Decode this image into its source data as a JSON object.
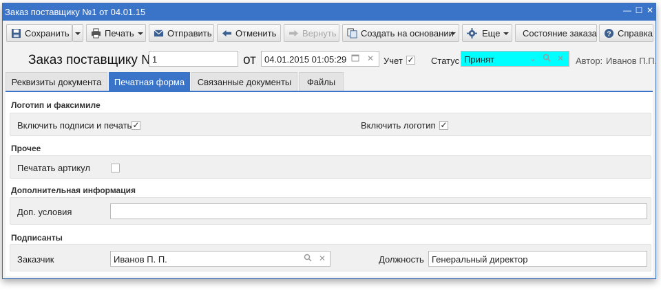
{
  "window": {
    "title": "Заказ поставщику №1 от 04.01.15",
    "controls": {
      "minimize": "—",
      "maximize": "☐",
      "close": "✕"
    }
  },
  "toolbar": {
    "save": "Сохранить",
    "print": "Печать",
    "send": "Отправить",
    "cancel": "Отменить",
    "return": "Вернуть",
    "create_basis": "Создать на основании",
    "more": "Еще",
    "order_status": "Состояние заказа",
    "help": "Справка"
  },
  "doc": {
    "title": "Заказ поставщику №",
    "number": "1",
    "from_label": "от",
    "date": "04.01.2015 01:05:29",
    "accounting_label": "Учет",
    "accounting_checked": true,
    "status_label": "Статус",
    "status_value": "Принят",
    "status_color": "#00ffff",
    "author_label": "Автор:",
    "author_value": "Иванов П.П."
  },
  "tabs": [
    {
      "label": "Реквизиты документа",
      "active": false
    },
    {
      "label": "Печатная форма",
      "active": true
    },
    {
      "label": "Связанные документы",
      "active": false
    },
    {
      "label": "Файлы",
      "active": false
    }
  ],
  "sections": {
    "logo": {
      "title": "Логотип и факсимиле",
      "include_signatures_label": "Включить подписи и печать",
      "include_signatures_checked": true,
      "include_logo_label": "Включить логотип",
      "include_logo_checked": true
    },
    "other": {
      "title": "Прочее",
      "print_article_label": "Печатать артикул",
      "print_article_checked": false
    },
    "additional": {
      "title": "Дополнительная информация",
      "conditions_label": "Доп. условия",
      "conditions_value": ""
    },
    "signers": {
      "title": "Подписанты",
      "customer_label": "Заказчик",
      "customer_value": "Иванов  П. П.",
      "position_label": "Должность",
      "position_value": "Генеральный директор"
    }
  },
  "accent_color": "#3a74c8"
}
